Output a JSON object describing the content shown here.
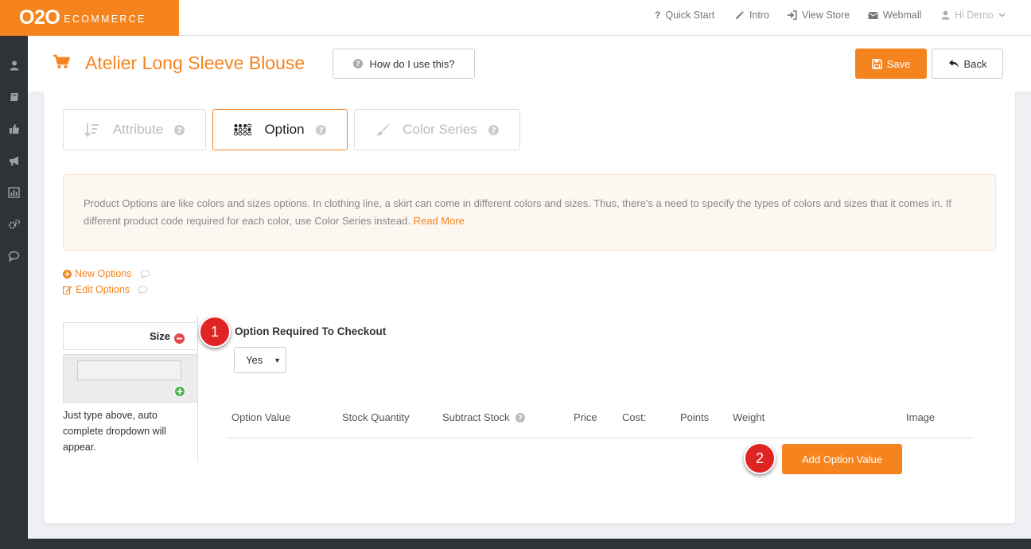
{
  "brand": {
    "logo_main": "O2O",
    "logo_sub": "ECOMMERCE"
  },
  "topnav": {
    "quick_start": "Quick Start",
    "intro": "Intro",
    "view_store": "View Store",
    "webmail": "Webmall",
    "user": "Hi Demo"
  },
  "header": {
    "title": "Atelier Long Sleeve Blouse",
    "help_label": "How do I use this?",
    "save_label": "Save",
    "back_label": "Back"
  },
  "tabs": [
    {
      "label": "Attribute",
      "active": false
    },
    {
      "label": "Option",
      "active": true
    },
    {
      "label": "Color Series",
      "active": false
    }
  ],
  "info": {
    "text": "Product Options are like colors and sizes options. In clothing line, a skirt can come in different colors and sizes. Thus, there's a need to specify the types of colors and sizes that it comes in. If different product code required for each color, use Color Series instead.",
    "read_more": "Read More"
  },
  "links": {
    "new_options": "New Options",
    "edit_options": "Edit Options"
  },
  "option": {
    "name": "Size",
    "input_value": "",
    "hint": "Just type above, auto complete dropdown will appear."
  },
  "required": {
    "label": "Option Required To Checkout",
    "value": "Yes"
  },
  "table": {
    "headers": [
      "Option Value",
      "Stock Quantity",
      "Subtract Stock",
      "Price",
      "Cost:",
      "Points",
      "Weight",
      "Image"
    ]
  },
  "add_value_label": "Add Option Value",
  "badges": [
    "1",
    "2"
  ],
  "colors": {
    "accent": "#f5841f",
    "sidebar": "#2f3237",
    "badge": "#e02424"
  }
}
